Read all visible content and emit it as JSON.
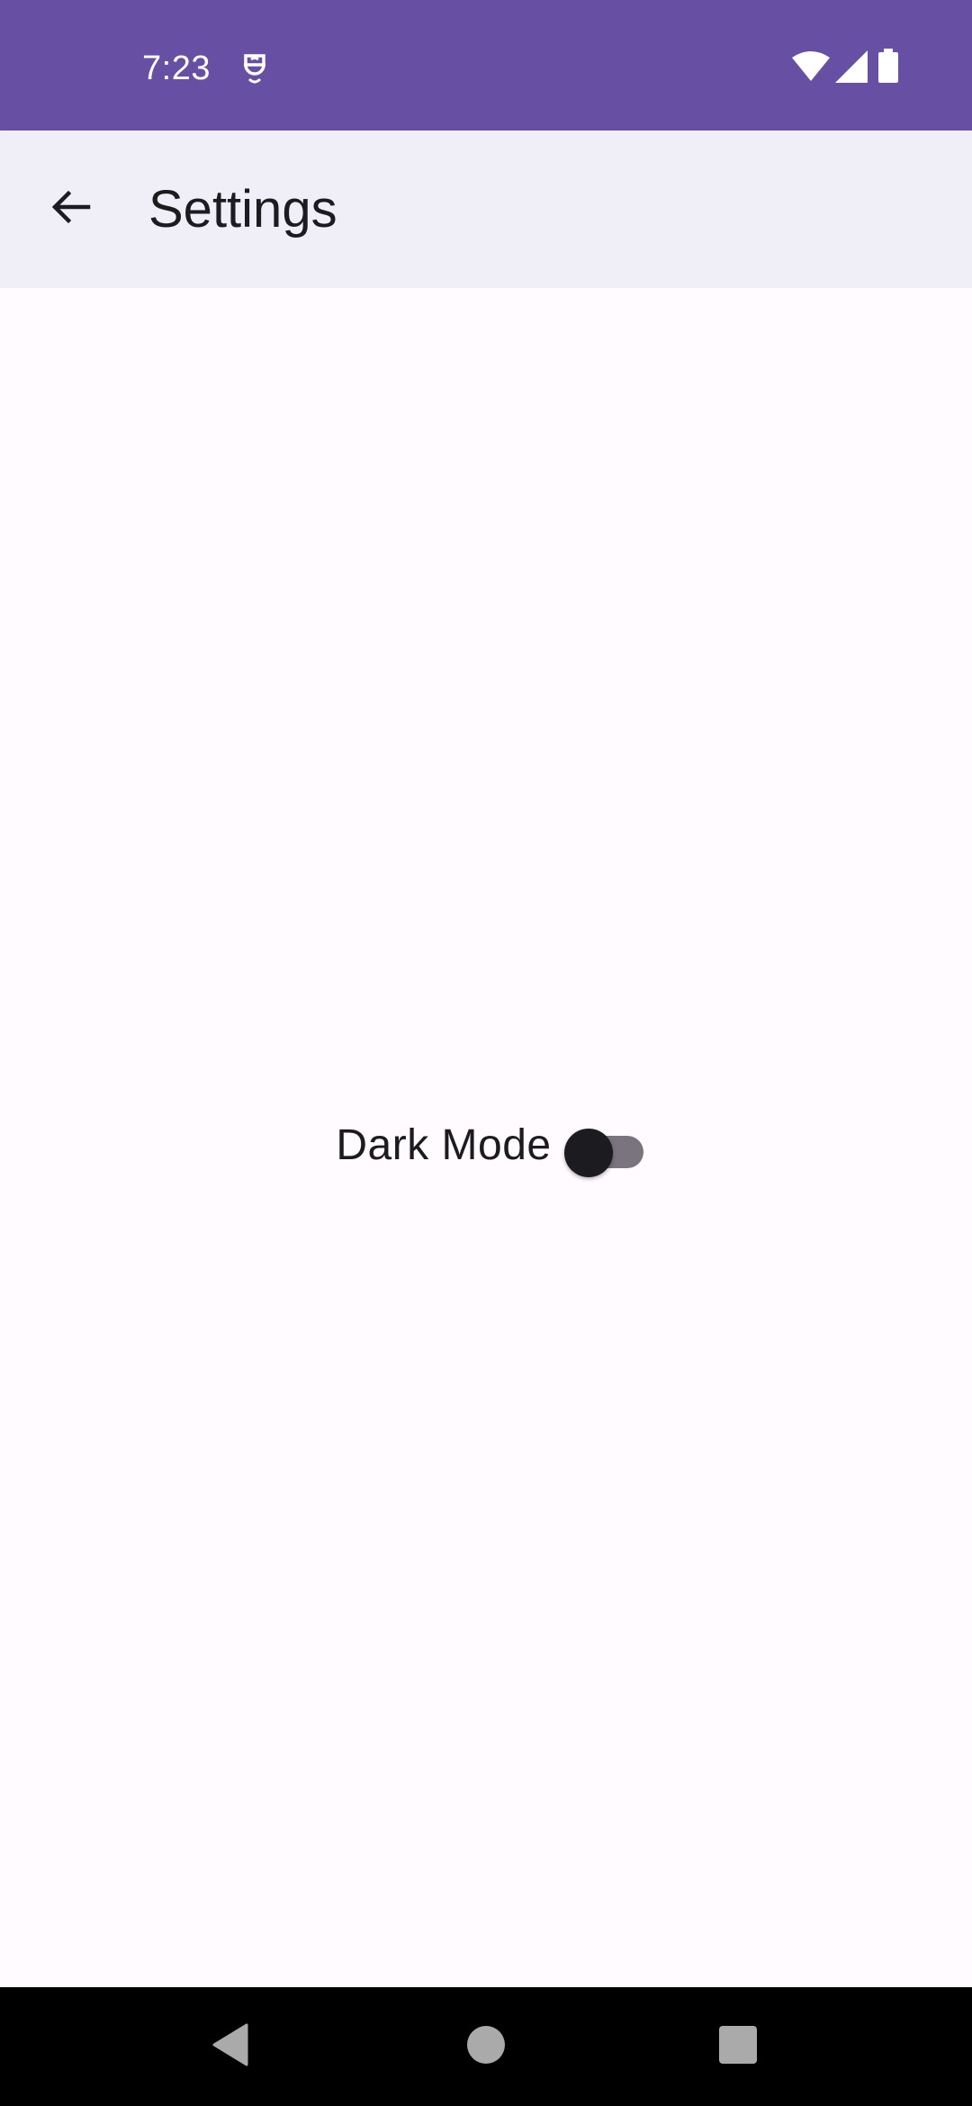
{
  "status_bar": {
    "time": "7:23",
    "app_icon": "accessibility-guard-icon",
    "wifi_icon": "wifi-icon",
    "signal_icon": "cellular-signal-icon",
    "battery_icon": "battery-icon",
    "background_color": "#6750A4"
  },
  "app_bar": {
    "back_icon": "arrow-back-icon",
    "title": "Settings",
    "background_color": "#F0EEF6"
  },
  "settings": {
    "dark_mode_label": "Dark Mode",
    "dark_mode_enabled": false
  },
  "nav_bar": {
    "back_icon": "nav-back-triangle-icon",
    "home_icon": "nav-home-circle-icon",
    "recents_icon": "nav-recents-square-icon"
  }
}
